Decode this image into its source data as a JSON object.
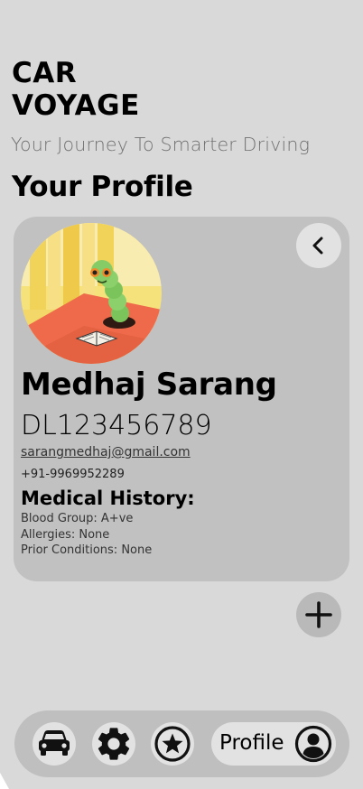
{
  "app": {
    "title": "CAR\nVOYAGE",
    "tagline": "Your Journey To Smarter Driving"
  },
  "page": {
    "title": "Your Profile"
  },
  "profile": {
    "name": "Medhaj Sarang",
    "license": "DL123456789",
    "email": "sarangmedhaj@gmail.com",
    "phone": "+91-9969952289",
    "medical": {
      "heading": "Medical History:",
      "blood_group": "Blood Group: A+ve",
      "allergies": "Allergies: None",
      "prior_conditions": "Prior Conditions: None"
    },
    "avatar_icon": "caterpillar-reading-avatar",
    "back_icon": "chevron-left-icon"
  },
  "actions": {
    "add_icon": "plus-icon"
  },
  "nav": {
    "items": [
      {
        "icon": "car-icon"
      },
      {
        "icon": "gear-icon"
      },
      {
        "icon": "star-icon"
      }
    ],
    "profile_label": "Profile",
    "profile_icon": "user-circle-icon"
  }
}
